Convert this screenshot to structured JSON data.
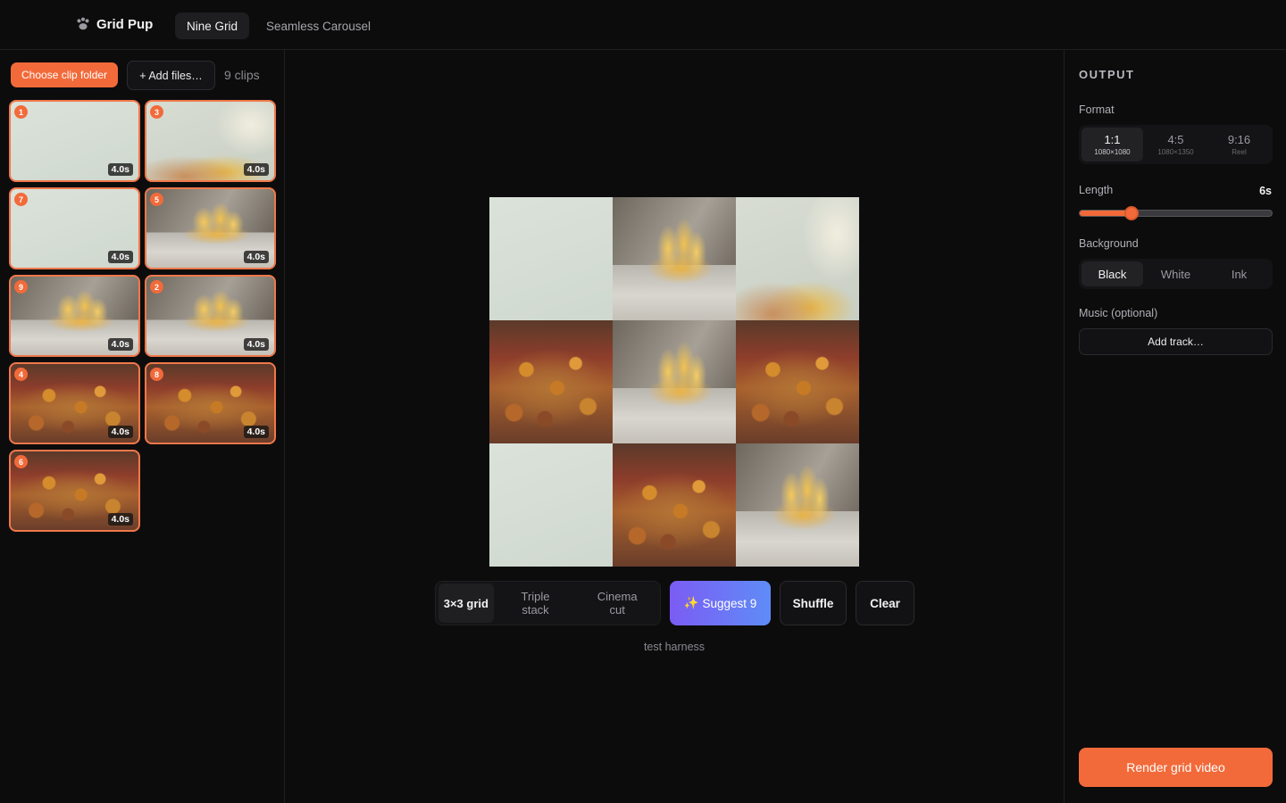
{
  "app": {
    "name": "Grid Pup",
    "tabs": [
      {
        "label": "Nine Grid",
        "active": true
      },
      {
        "label": "Seamless Carousel",
        "active": false
      }
    ]
  },
  "clips_panel": {
    "choose_folder_label": "Choose clip folder",
    "add_files_label": "+ Add files…",
    "clip_count": "9 clips",
    "clips": [
      {
        "number": "1",
        "duration": "4.0s",
        "image": "blank"
      },
      {
        "number": "3",
        "duration": "4.0s",
        "image": "hand"
      },
      {
        "number": "7",
        "duration": "4.0s",
        "image": "blank"
      },
      {
        "number": "5",
        "duration": "4.0s",
        "image": "fries"
      },
      {
        "number": "9",
        "duration": "4.0s",
        "image": "fries"
      },
      {
        "number": "2",
        "duration": "4.0s",
        "image": "fries"
      },
      {
        "number": "4",
        "duration": "4.0s",
        "image": "food"
      },
      {
        "number": "8",
        "duration": "4.0s",
        "image": "food"
      },
      {
        "number": "6",
        "duration": "4.0s",
        "image": "food"
      }
    ]
  },
  "preview": {
    "cells": [
      "blank",
      "fries",
      "hand",
      "food",
      "fries",
      "food",
      "blank",
      "food",
      "fries"
    ]
  },
  "layout_options": [
    {
      "label": "3×3 grid",
      "active": true
    },
    {
      "label": "Triple stack",
      "active": false
    },
    {
      "label": "Cinema cut",
      "active": false
    }
  ],
  "actions": {
    "suggest_label": "Suggest 9",
    "shuffle_label": "Shuffle",
    "clear_label": "Clear"
  },
  "harness_text": "test harness",
  "output": {
    "section_title": "OUTPUT",
    "format_label": "Format",
    "formats": [
      {
        "ratio": "1:1",
        "size": "1080×1080",
        "active": true
      },
      {
        "ratio": "4:5",
        "size": "1080×1350",
        "active": false
      },
      {
        "ratio": "9:16",
        "size": "Reel",
        "active": false
      }
    ],
    "length_label": "Length",
    "length_value": "6s",
    "length_fraction": 0.27,
    "background_label": "Background",
    "backgrounds": [
      {
        "label": "Black",
        "active": true
      },
      {
        "label": "White",
        "active": false
      },
      {
        "label": "Ink",
        "active": false
      }
    ],
    "music_label": "Music (optional)",
    "add_track_label": "Add track…",
    "render_label": "Render grid video"
  },
  "colors": {
    "accent": "#f26a3a",
    "gradient_start": "#7b5cf4",
    "gradient_end": "#5f8cf7"
  }
}
